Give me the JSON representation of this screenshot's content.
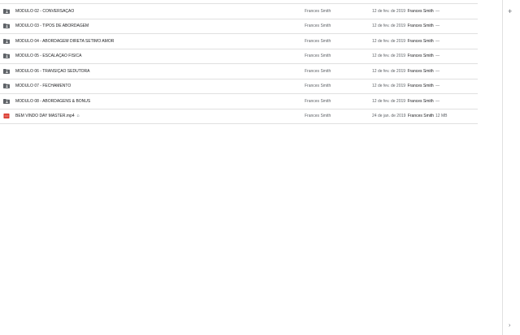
{
  "files": [
    {
      "name": "MODULO 02 - CONVERSAÇAO",
      "type": "folder",
      "shared_icon": "",
      "owner": "Frances Smith",
      "modified_date": "12 de fev. de 2019",
      "modified_by": "Frances Smith",
      "size": "—"
    },
    {
      "name": "MODULO 03 - TIPOS DE ABORDAGEM",
      "type": "folder",
      "shared_icon": "",
      "owner": "Frances Smith",
      "modified_date": "12 de fev. de 2019",
      "modified_by": "Frances Smith",
      "size": "—"
    },
    {
      "name": "MODULO 04 - ABORDAGEM DIRETA SETIMO AMOR",
      "type": "folder",
      "shared_icon": "",
      "owner": "Frances Smith",
      "modified_date": "12 de fev. de 2019",
      "modified_by": "Frances Smith",
      "size": "—"
    },
    {
      "name": "MODULO 05 - ESCALAÇAO FISICA",
      "type": "folder",
      "shared_icon": "",
      "owner": "Frances Smith",
      "modified_date": "12 de fev. de 2019",
      "modified_by": "Frances Smith",
      "size": "—"
    },
    {
      "name": "MODULO 06 - TRANSIÇAO SEDUTORA",
      "type": "folder",
      "shared_icon": "",
      "owner": "Frances Smith",
      "modified_date": "12 de fev. de 2019",
      "modified_by": "Frances Smith",
      "size": "—"
    },
    {
      "name": "MODULO 07 - FECHAMENTO",
      "type": "folder",
      "shared_icon": "",
      "owner": "Frances Smith",
      "modified_date": "12 de fev. de 2019",
      "modified_by": "Frances Smith",
      "size": "—"
    },
    {
      "name": "MODULO 08 - ABORDAGENS & BONUS",
      "type": "folder",
      "shared_icon": "",
      "owner": "Frances Smith",
      "modified_date": "12 de fev. de 2019",
      "modified_by": "Frances Smith",
      "size": "—"
    },
    {
      "name": "BEM VINDO DAY MASTER.mp4",
      "type": "video",
      "shared_icon": "ꭥ",
      "owner": "Frances Smith",
      "modified_date": "24 de jan. de 2019",
      "modified_by": "Frances Smith",
      "size": "12 MB"
    }
  ],
  "side_panel": {
    "add_icon": "+",
    "expand_icon": "›"
  },
  "colors": {
    "folder": "#5f6368",
    "video": "#d93025",
    "border": "#e0e0e0"
  }
}
